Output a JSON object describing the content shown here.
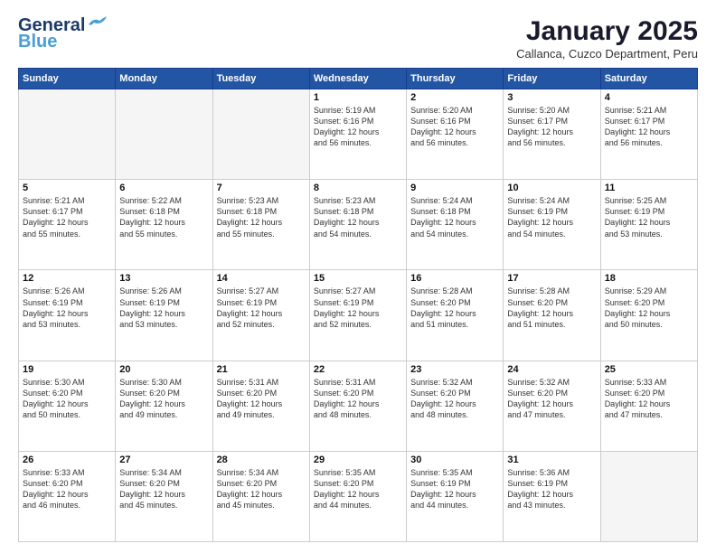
{
  "header": {
    "logo_line1": "General",
    "logo_line2": "Blue",
    "month": "January 2025",
    "location": "Callanca, Cuzco Department, Peru"
  },
  "weekdays": [
    "Sunday",
    "Monday",
    "Tuesday",
    "Wednesday",
    "Thursday",
    "Friday",
    "Saturday"
  ],
  "weeks": [
    [
      {
        "day": "",
        "info": ""
      },
      {
        "day": "",
        "info": ""
      },
      {
        "day": "",
        "info": ""
      },
      {
        "day": "1",
        "info": "Sunrise: 5:19 AM\nSunset: 6:16 PM\nDaylight: 12 hours\nand 56 minutes."
      },
      {
        "day": "2",
        "info": "Sunrise: 5:20 AM\nSunset: 6:16 PM\nDaylight: 12 hours\nand 56 minutes."
      },
      {
        "day": "3",
        "info": "Sunrise: 5:20 AM\nSunset: 6:17 PM\nDaylight: 12 hours\nand 56 minutes."
      },
      {
        "day": "4",
        "info": "Sunrise: 5:21 AM\nSunset: 6:17 PM\nDaylight: 12 hours\nand 56 minutes."
      }
    ],
    [
      {
        "day": "5",
        "info": "Sunrise: 5:21 AM\nSunset: 6:17 PM\nDaylight: 12 hours\nand 55 minutes."
      },
      {
        "day": "6",
        "info": "Sunrise: 5:22 AM\nSunset: 6:18 PM\nDaylight: 12 hours\nand 55 minutes."
      },
      {
        "day": "7",
        "info": "Sunrise: 5:23 AM\nSunset: 6:18 PM\nDaylight: 12 hours\nand 55 minutes."
      },
      {
        "day": "8",
        "info": "Sunrise: 5:23 AM\nSunset: 6:18 PM\nDaylight: 12 hours\nand 54 minutes."
      },
      {
        "day": "9",
        "info": "Sunrise: 5:24 AM\nSunset: 6:18 PM\nDaylight: 12 hours\nand 54 minutes."
      },
      {
        "day": "10",
        "info": "Sunrise: 5:24 AM\nSunset: 6:19 PM\nDaylight: 12 hours\nand 54 minutes."
      },
      {
        "day": "11",
        "info": "Sunrise: 5:25 AM\nSunset: 6:19 PM\nDaylight: 12 hours\nand 53 minutes."
      }
    ],
    [
      {
        "day": "12",
        "info": "Sunrise: 5:26 AM\nSunset: 6:19 PM\nDaylight: 12 hours\nand 53 minutes."
      },
      {
        "day": "13",
        "info": "Sunrise: 5:26 AM\nSunset: 6:19 PM\nDaylight: 12 hours\nand 53 minutes."
      },
      {
        "day": "14",
        "info": "Sunrise: 5:27 AM\nSunset: 6:19 PM\nDaylight: 12 hours\nand 52 minutes."
      },
      {
        "day": "15",
        "info": "Sunrise: 5:27 AM\nSunset: 6:19 PM\nDaylight: 12 hours\nand 52 minutes."
      },
      {
        "day": "16",
        "info": "Sunrise: 5:28 AM\nSunset: 6:20 PM\nDaylight: 12 hours\nand 51 minutes."
      },
      {
        "day": "17",
        "info": "Sunrise: 5:28 AM\nSunset: 6:20 PM\nDaylight: 12 hours\nand 51 minutes."
      },
      {
        "day": "18",
        "info": "Sunrise: 5:29 AM\nSunset: 6:20 PM\nDaylight: 12 hours\nand 50 minutes."
      }
    ],
    [
      {
        "day": "19",
        "info": "Sunrise: 5:30 AM\nSunset: 6:20 PM\nDaylight: 12 hours\nand 50 minutes."
      },
      {
        "day": "20",
        "info": "Sunrise: 5:30 AM\nSunset: 6:20 PM\nDaylight: 12 hours\nand 49 minutes."
      },
      {
        "day": "21",
        "info": "Sunrise: 5:31 AM\nSunset: 6:20 PM\nDaylight: 12 hours\nand 49 minutes."
      },
      {
        "day": "22",
        "info": "Sunrise: 5:31 AM\nSunset: 6:20 PM\nDaylight: 12 hours\nand 48 minutes."
      },
      {
        "day": "23",
        "info": "Sunrise: 5:32 AM\nSunset: 6:20 PM\nDaylight: 12 hours\nand 48 minutes."
      },
      {
        "day": "24",
        "info": "Sunrise: 5:32 AM\nSunset: 6:20 PM\nDaylight: 12 hours\nand 47 minutes."
      },
      {
        "day": "25",
        "info": "Sunrise: 5:33 AM\nSunset: 6:20 PM\nDaylight: 12 hours\nand 47 minutes."
      }
    ],
    [
      {
        "day": "26",
        "info": "Sunrise: 5:33 AM\nSunset: 6:20 PM\nDaylight: 12 hours\nand 46 minutes."
      },
      {
        "day": "27",
        "info": "Sunrise: 5:34 AM\nSunset: 6:20 PM\nDaylight: 12 hours\nand 45 minutes."
      },
      {
        "day": "28",
        "info": "Sunrise: 5:34 AM\nSunset: 6:20 PM\nDaylight: 12 hours\nand 45 minutes."
      },
      {
        "day": "29",
        "info": "Sunrise: 5:35 AM\nSunset: 6:20 PM\nDaylight: 12 hours\nand 44 minutes."
      },
      {
        "day": "30",
        "info": "Sunrise: 5:35 AM\nSunset: 6:19 PM\nDaylight: 12 hours\nand 44 minutes."
      },
      {
        "day": "31",
        "info": "Sunrise: 5:36 AM\nSunset: 6:19 PM\nDaylight: 12 hours\nand 43 minutes."
      },
      {
        "day": "",
        "info": ""
      }
    ]
  ]
}
